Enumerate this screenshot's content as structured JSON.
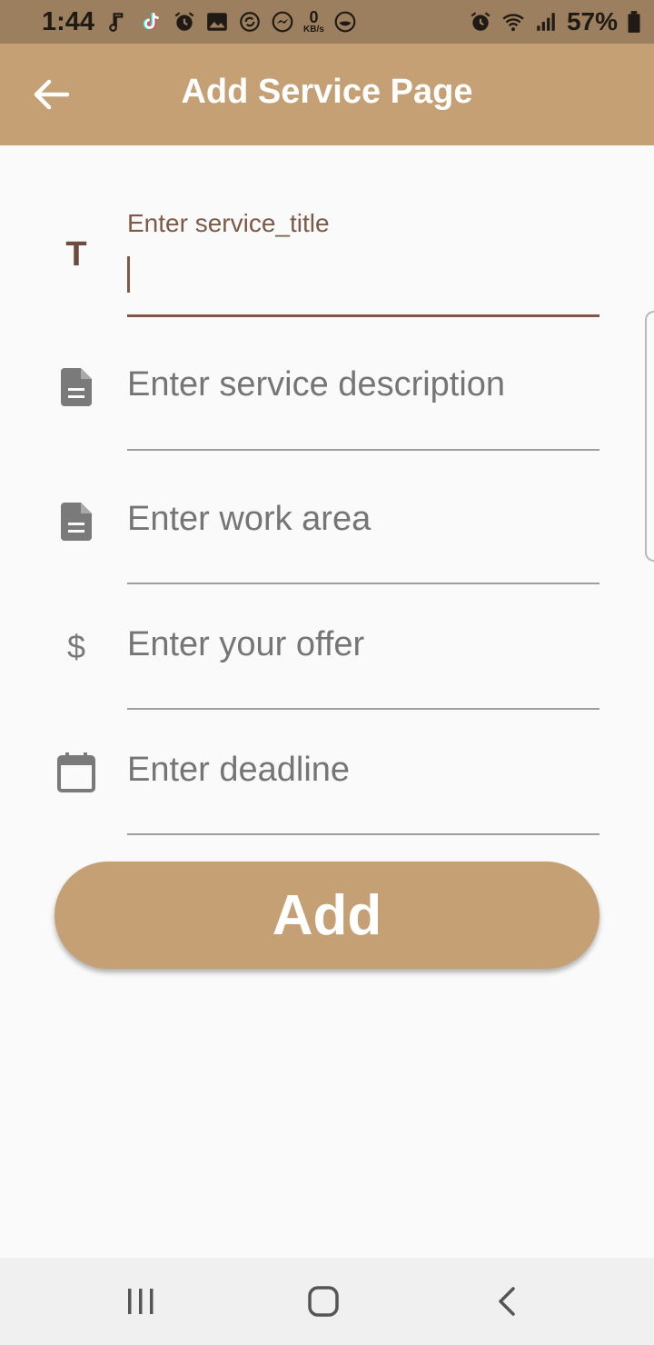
{
  "status_bar": {
    "time": "1:44",
    "network_speed_value": "0",
    "network_speed_unit": "KB/s",
    "battery_percent": "57%"
  },
  "app_bar": {
    "title": "Add Service Page",
    "back_icon": "arrow-back-icon",
    "background_color": "#c6a075"
  },
  "form": {
    "service_title": {
      "label": "Enter service_title",
      "value": "",
      "icon": "title-t-icon",
      "icon_text": "T"
    },
    "service_description": {
      "placeholder": "Enter service description",
      "icon": "document-icon"
    },
    "work_area": {
      "placeholder": "Enter work area",
      "icon": "document-icon"
    },
    "offer": {
      "placeholder": "Enter your offer",
      "icon": "dollar-icon",
      "icon_text": "$"
    },
    "deadline": {
      "placeholder": "Enter deadline",
      "icon": "calendar-icon"
    }
  },
  "add_button": {
    "label": "Add"
  },
  "colors": {
    "accent": "#c6a075",
    "active_field": "#7b5a48",
    "status_bar": "#9b7f5e"
  },
  "nav_bar": {
    "recents_icon": "recents-icon",
    "home_icon": "home-icon",
    "back_icon": "back-chevron-icon"
  }
}
